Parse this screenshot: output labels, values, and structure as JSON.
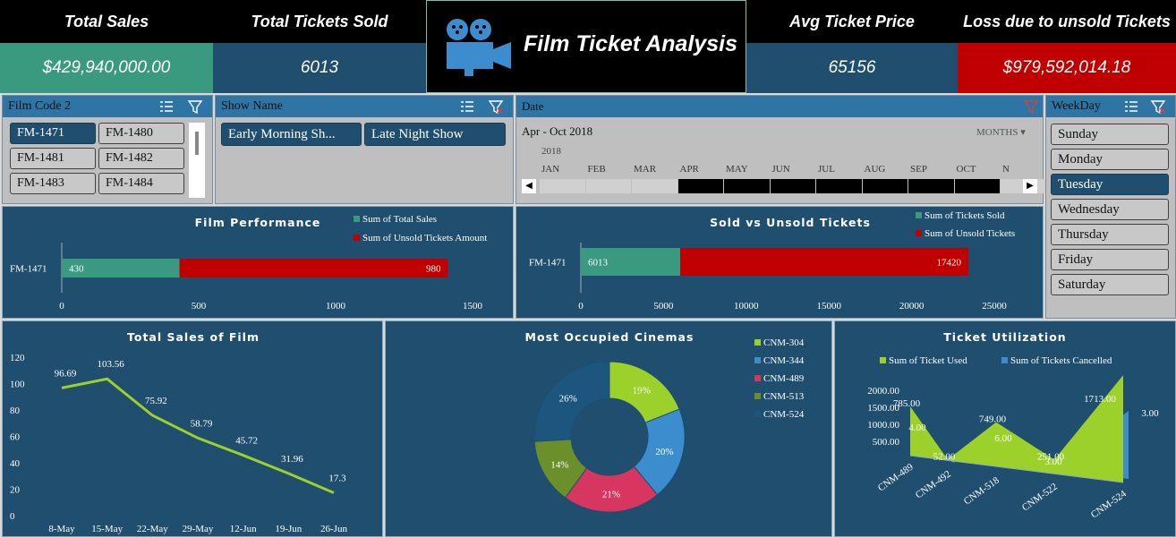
{
  "kpis": {
    "total_sales": {
      "label": "Total Sales",
      "value": "$429,940,000.00"
    },
    "tickets_sold": {
      "label": "Total Tickets Sold",
      "value": "6013"
    },
    "avg_price": {
      "label": "Avg Ticket Price",
      "value": "65156"
    },
    "loss": {
      "label": "Loss due to unsold Tickets",
      "value": "$979,592,014.18"
    }
  },
  "title": "Film Ticket Analysis",
  "colors": {
    "teal": "#3a9a80",
    "red": "#c00000",
    "navy": "#1f4e6e",
    "lime": "#9bd12a",
    "blue": "#3c8dce",
    "pink": "#d6365f",
    "olive": "#6a8f2b",
    "dark_blue": "#1c567f"
  },
  "slicers": {
    "film_code": {
      "label": "Film Code 2",
      "items": [
        "FM-1471",
        "FM-1480",
        "FM-1481",
        "FM-1482",
        "FM-1483",
        "FM-1484"
      ],
      "selected": "FM-1471"
    },
    "show_name": {
      "label": "Show Name",
      "items": [
        "Early Morning Sh...",
        "Late Night Show"
      ]
    },
    "date": {
      "label": "Date",
      "range": "Apr - Oct 2018",
      "level": "MONTHS",
      "year": "2018",
      "months": [
        "JAN",
        "FEB",
        "MAR",
        "APR",
        "MAY",
        "JUN",
        "JUL",
        "AUG",
        "SEP",
        "OCT",
        "N"
      ]
    },
    "weekday": {
      "label": "WeekDay",
      "items": [
        "Sunday",
        "Monday",
        "Tuesday",
        "Wednesday",
        "Thursday",
        "Friday",
        "Saturday"
      ],
      "selected": "Tuesday"
    }
  },
  "chart_data": [
    {
      "type": "bar",
      "title": "Film Performance",
      "categories": [
        "FM-1471"
      ],
      "series": [
        {
          "name": "Sum of Total Sales",
          "values": [
            430
          ],
          "color": "#3a9a80"
        },
        {
          "name": "Sum of Unsold Tickets Amount",
          "values": [
            980
          ],
          "color": "#c00000"
        }
      ],
      "stacked": true,
      "orientation": "horizontal",
      "xlim": [
        0,
        1500
      ],
      "ticks": [
        "0",
        "500",
        "1000",
        "1500"
      ],
      "legend": "top-right"
    },
    {
      "type": "bar",
      "title": "Sold vs Unsold Tickets",
      "categories": [
        "FM-1471"
      ],
      "series": [
        {
          "name": "Sum of Tickets Sold",
          "values": [
            6013
          ],
          "color": "#3a9a80"
        },
        {
          "name": "Sum of Unsold Tickets",
          "values": [
            17420
          ],
          "color": "#c00000"
        }
      ],
      "stacked": true,
      "orientation": "horizontal",
      "xlim": [
        0,
        25000
      ],
      "ticks": [
        "0",
        "5000",
        "10000",
        "15000",
        "20000",
        "25000"
      ],
      "legend": "top-right"
    },
    {
      "type": "line",
      "title": "Total Sales of Film",
      "x": [
        "8-May",
        "15-May",
        "22-May",
        "29-May",
        "12-Jun",
        "19-Jun",
        "26-Jun"
      ],
      "values": [
        96.69,
        103.56,
        75.92,
        58.79,
        45.72,
        31.96,
        17.3
      ],
      "labels": [
        "96.69",
        "103.56",
        "75.92",
        "58.79",
        "45.72",
        "31.96",
        "17.3"
      ],
      "ylim": [
        0,
        120
      ],
      "yticks": [
        "0",
        "20",
        "40",
        "60",
        "80",
        "100",
        "120"
      ],
      "color": "#9bd12a"
    },
    {
      "type": "pie",
      "title": "Most Occupied Cinemas",
      "categories": [
        "CNM-304",
        "CNM-344",
        "CNM-489",
        "CNM-513",
        "CNM-524"
      ],
      "values": [
        19,
        20,
        21,
        14,
        26
      ],
      "labels": [
        "19%",
        "20%",
        "21%",
        "14%",
        "26%"
      ],
      "colors": [
        "#9bd12a",
        "#3c8dce",
        "#d6365f",
        "#6a8f2b",
        "#1c567f"
      ],
      "donut": true,
      "legend": "right"
    },
    {
      "type": "area",
      "title": "Ticket Utilization",
      "categories": [
        "CNM-489",
        "CNM-492",
        "CNM-518",
        "CNM-522",
        "CNM-524"
      ],
      "series": [
        {
          "name": "Sum of Ticket Used",
          "values": [
            785,
            52,
            749,
            251,
            1713
          ],
          "labels": [
            "785.00",
            "52.00",
            "749.00",
            "251.00",
            "1713.00"
          ],
          "color": "#9bd12a"
        },
        {
          "name": "Sum of Tickets Cancelled",
          "values": [
            4,
            0,
            6,
            3,
            3
          ],
          "labels": [
            "4.00",
            "",
            "6.00",
            "3.00",
            "3.00"
          ],
          "color": "#3c8dce"
        }
      ],
      "yticks": [
        "500.00",
        "1000.00",
        "1500.00",
        "2000.00"
      ],
      "legend": "top"
    }
  ]
}
